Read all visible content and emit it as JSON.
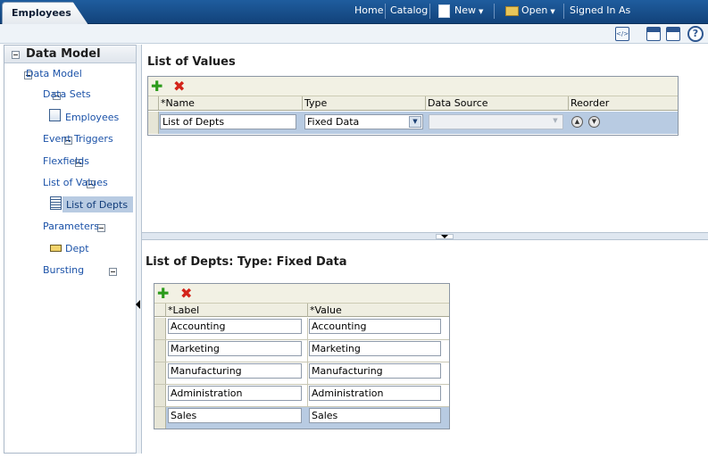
{
  "app": {
    "tab_title": "Employees"
  },
  "topnav": {
    "home": "Home",
    "catalog": "Catalog",
    "new": "New",
    "open": "Open",
    "signed_in": "Signed In As"
  },
  "sidebar": {
    "title": "Data Model",
    "items": [
      {
        "label": "Data Model"
      },
      {
        "label": "Data Sets"
      },
      {
        "label": "Employees"
      },
      {
        "label": "Event Triggers"
      },
      {
        "label": "Flexfields"
      },
      {
        "label": "List of Values"
      },
      {
        "label": "List of Depts"
      },
      {
        "label": "Parameters"
      },
      {
        "label": "Dept"
      },
      {
        "label": "Bursting"
      }
    ]
  },
  "lov": {
    "title": "List of Values",
    "columns": {
      "required": "*",
      "name": "Name",
      "type": "Type",
      "datasource": "Data Source",
      "reorder": "Reorder"
    },
    "row": {
      "name": "List of Depts",
      "type": "Fixed Data",
      "datasource": ""
    }
  },
  "detail": {
    "title": "List of Depts: Type: Fixed Data",
    "columns": {
      "required": "*",
      "label": "Label",
      "value": "Value"
    },
    "rows": [
      {
        "label": "Accounting",
        "value": "Accounting"
      },
      {
        "label": "Marketing",
        "value": "Marketing"
      },
      {
        "label": "Manufacturing",
        "value": "Manufacturing"
      },
      {
        "label": "Administration",
        "value": "Administration"
      },
      {
        "label": "Sales",
        "value": "Sales"
      }
    ]
  },
  "colors": {
    "topbar": "#1f5d9e",
    "selection": "#b8cbe2",
    "link": "#1b52a8"
  }
}
